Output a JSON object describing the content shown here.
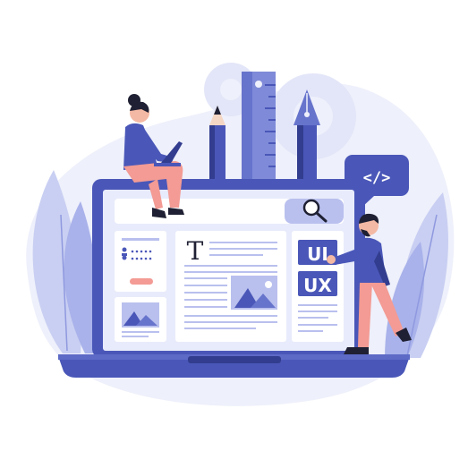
{
  "illustration": {
    "colors": {
      "primary": "#4a57b8",
      "primary_dark": "#323d8f",
      "light": "#e6e9fb",
      "pale": "#f1f2fc",
      "accent": "#f39b94",
      "skin": "#f4b9a4",
      "dark": "#1f2033"
    },
    "labels": {
      "text_icon": "T",
      "ui_label": "UI",
      "ux_label": "UX",
      "code_label": "</>"
    },
    "icons": [
      "search-icon",
      "image-icon",
      "pencil-icon",
      "ruler-icon",
      "pen-nib-icon",
      "gear-icon",
      "code-icon",
      "user-icon"
    ]
  }
}
